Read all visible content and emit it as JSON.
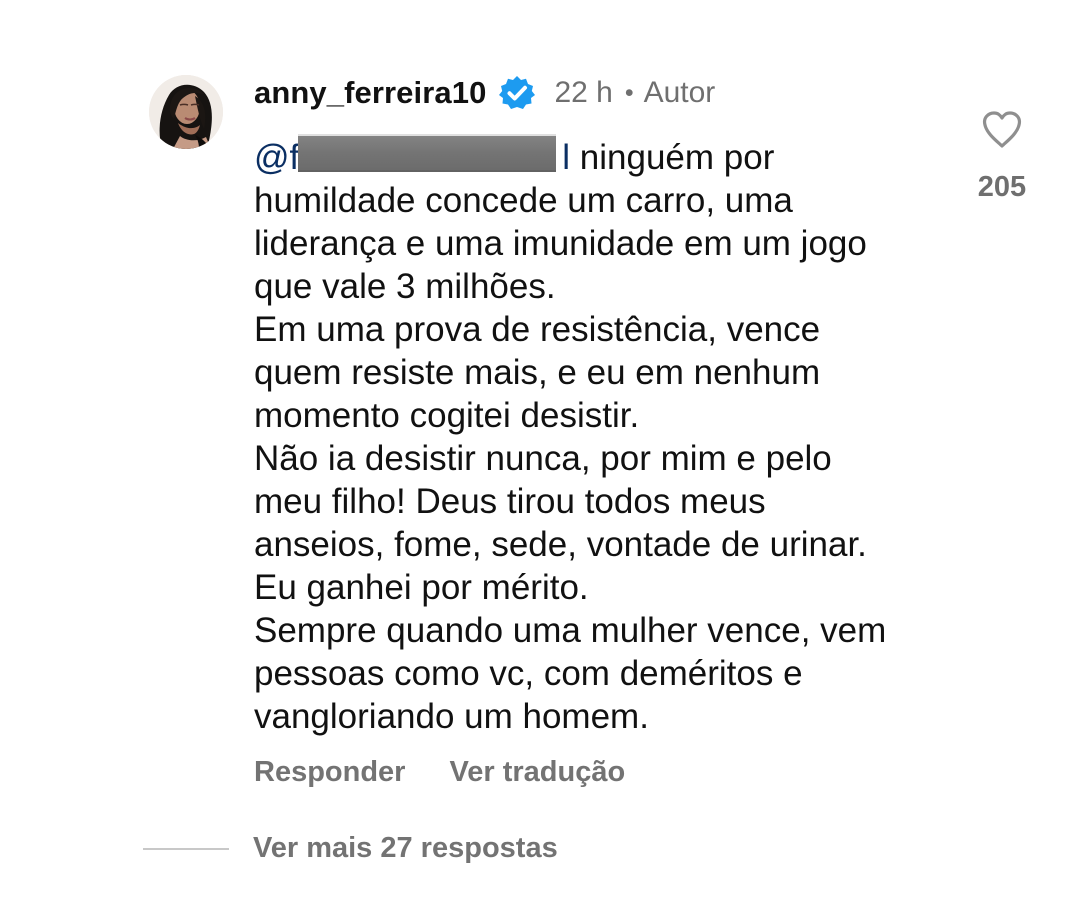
{
  "comment": {
    "username": "anny_ferreira10",
    "time": "22 h",
    "separator": "•",
    "author_label": "Autor",
    "mention_prefix": "@",
    "mention_visible_start": "f",
    "mention_visible_end": "l",
    "body_lines": [
      "ninguém por",
      "humildade concede um carro, uma",
      "liderança e uma imunidade em um jogo",
      "que vale 3 milhões.",
      "Em uma prova de resistência, vence",
      "quem resiste mais,  e eu em nenhum",
      "momento cogitei desistir.",
      "Não ia desistir nunca, por mim e pelo",
      "meu filho! Deus tirou todos meus",
      "anseios, fome, sede, vontade de urinar.",
      "Eu ganhei por mérito.",
      "Sempre quando uma mulher vence, vem",
      "pessoas como vc, com deméritos e",
      "vangloriando um homem."
    ],
    "actions": {
      "reply_label": "Responder",
      "translate_label": "Ver tradução"
    },
    "likes": {
      "count": "205",
      "icon": "heart-icon"
    },
    "more_replies_label": "Ver mais 27 respostas"
  },
  "icons": {
    "verified": "verified-badge-icon",
    "like": "heart-outline-icon"
  },
  "colors": {
    "text": "#111111",
    "muted": "#6f6f6f",
    "mention": "#0b2f63",
    "verified": "#1d9bf0",
    "background": "#ffffff"
  }
}
